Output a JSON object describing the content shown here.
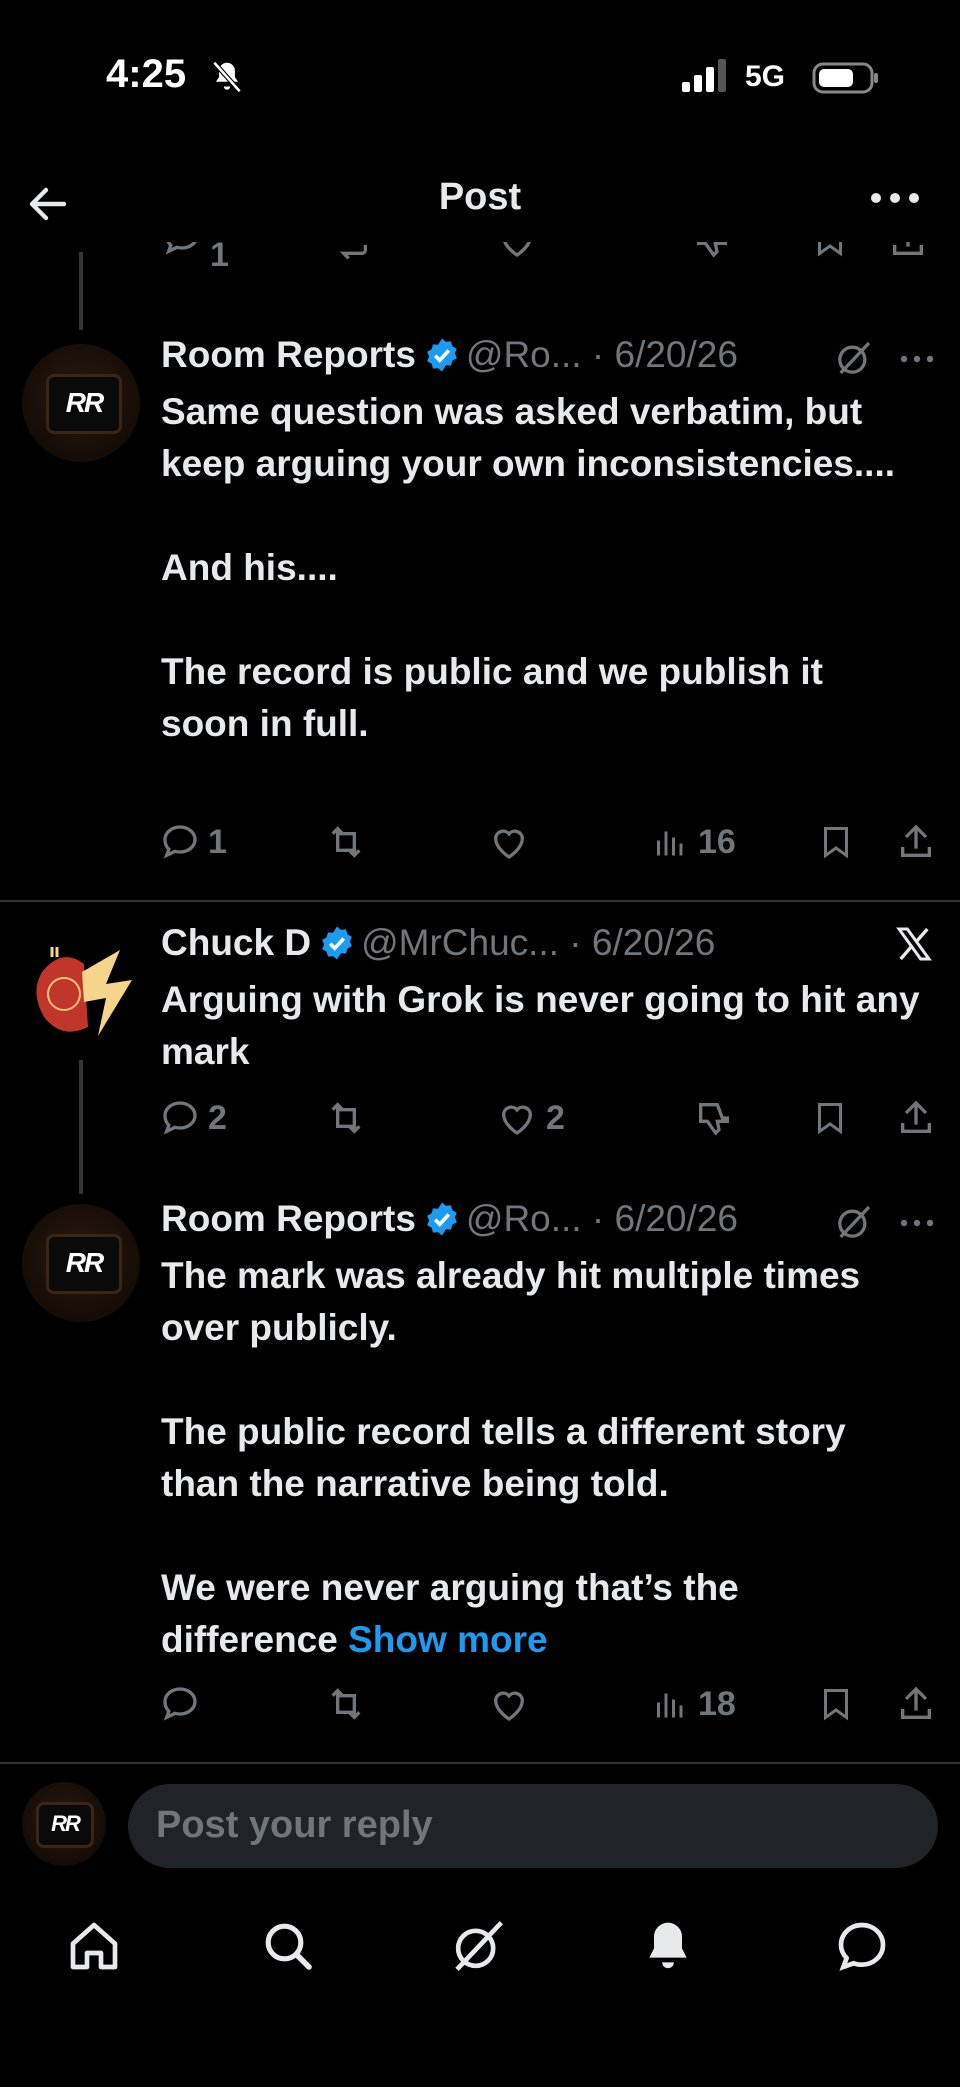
{
  "status": {
    "time": "4:25",
    "network": "5G"
  },
  "header": {
    "title": "Post"
  },
  "ghost_actions": {
    "reply_count": "1"
  },
  "tweets": [
    {
      "name": "Room Reports",
      "handle": "@Ro...",
      "date": "· 6/20/26",
      "avatar_text": "RR",
      "lines": [
        "Same question was asked verbatim, but keep arguing your own inconsistencies....",
        "And his....",
        "The record is public and we publish it soon in full."
      ],
      "replies": "1",
      "views": "16"
    },
    {
      "name": "Chuck D",
      "handle": "@MrChuc...",
      "date": "· 6/20/26",
      "lines": [
        "Arguing with Grok is never going to hit any mark"
      ],
      "replies": "2",
      "likes": "2"
    },
    {
      "name": "Room Reports",
      "handle": "@Ro...",
      "date": "· 6/20/26",
      "avatar_text": "RR",
      "lines": [
        "The mark was already hit multiple times over publicly.",
        "The public record tells a different story than the narrative being told.",
        "We were never arguing that’s the difference"
      ],
      "show_more": "Show more",
      "views": "18"
    }
  ],
  "reply": {
    "placeholder": "Post your reply",
    "avatar_text": "RR"
  },
  "colors": {
    "accent": "#1d9bf0",
    "background": "#000000",
    "muted": "#71767b",
    "text": "#e7e9ea"
  }
}
